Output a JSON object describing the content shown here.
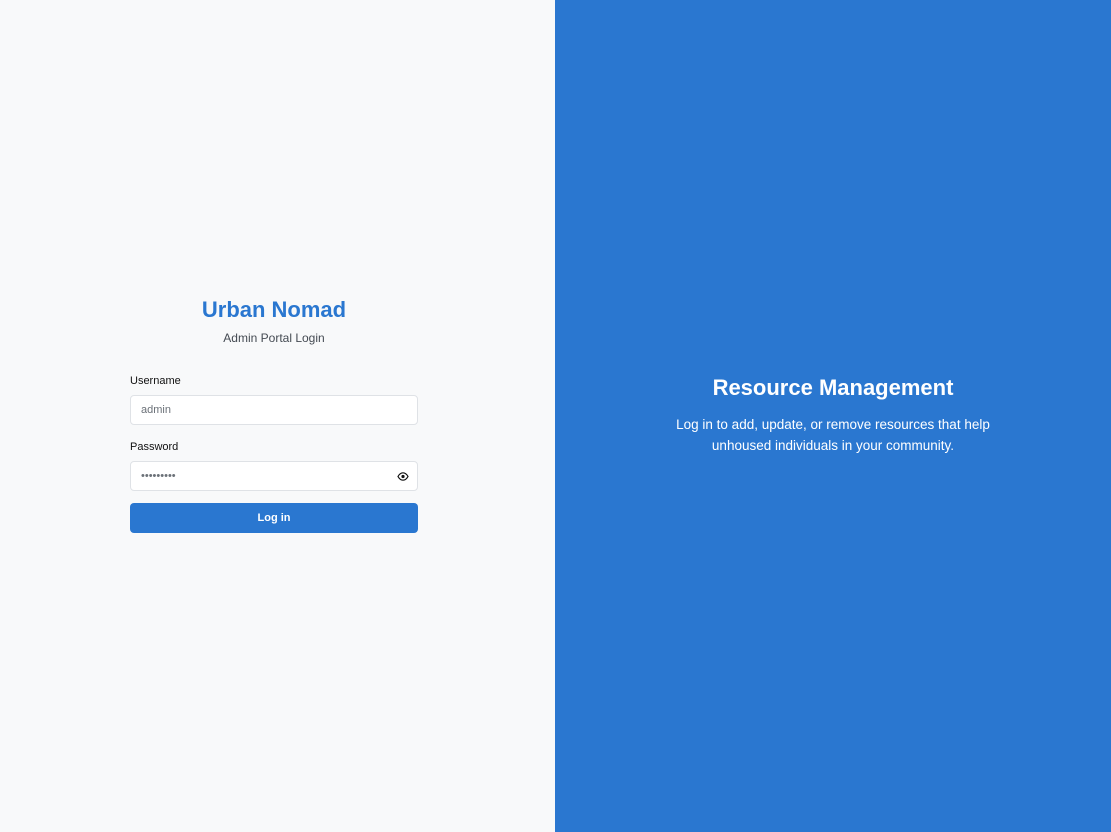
{
  "brand": {
    "name": "Urban Nomad",
    "subtitle": "Admin Portal Login",
    "accent_color": "#2a77d0"
  },
  "form": {
    "username": {
      "label": "Username",
      "value": "admin",
      "placeholder": ""
    },
    "password": {
      "label": "Password",
      "value": "password1",
      "toggle_icon": "eye-icon"
    },
    "submit_label": "Log in"
  },
  "promo": {
    "title": "Resource Management",
    "text": "Log in to add, update, or remove resources that help unhoused individuals in your community.",
    "background_color": "#2a77d0"
  }
}
